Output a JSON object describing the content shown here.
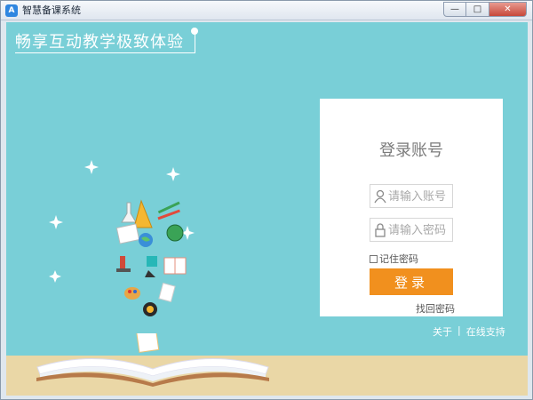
{
  "window": {
    "title": "智慧备课系统",
    "app_icon_glyph": "A",
    "minimize_glyph": "—",
    "maximize_glyph": "□",
    "close_glyph": "✕"
  },
  "banner": {
    "slogan": "畅享互动教学极致体验"
  },
  "login": {
    "title": "登录账号",
    "account_placeholder": "请输入账号",
    "password_placeholder": "请输入密码",
    "remember_label": "记住密码",
    "remember_checked": false,
    "submit_label": "登录",
    "forgot_label": "找回密码"
  },
  "footer": {
    "about_label": "关于",
    "separator": "|",
    "support_label": "在线支持"
  },
  "colors": {
    "background": "#79cfd7",
    "floor": "#ead7a6",
    "accent": "#f1901e",
    "card": "#ffffff"
  },
  "icons": {
    "account": "user-icon",
    "password": "lock-icon"
  }
}
